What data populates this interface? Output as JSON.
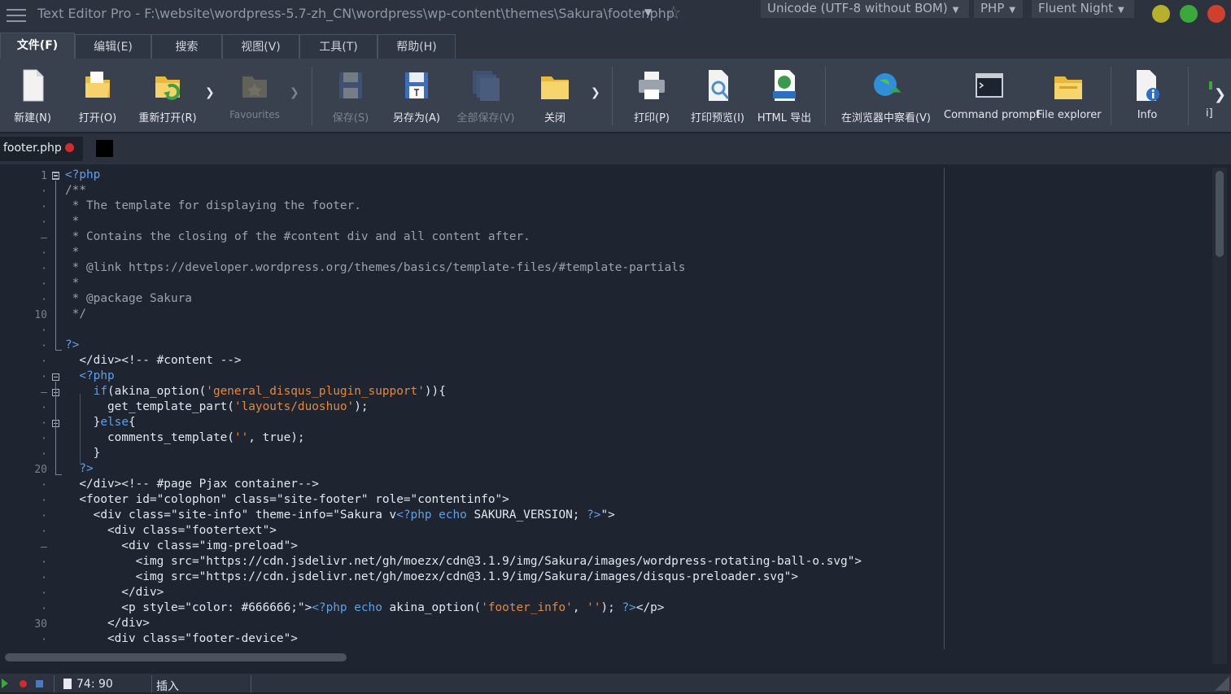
{
  "title": {
    "text": "Text Editor Pro  -  F:\\website\\wordpress-5.7-zh_CN\\wordpress\\wp-content\\themes\\Sakura\\footer.php",
    "encoding": "Unicode (UTF-8 without BOM)",
    "language": "PHP",
    "theme": "Fluent Night",
    "colors": {
      "minimize": "#b6b02a",
      "maximize": "#3aa83a",
      "close": "#d0402c"
    }
  },
  "menu_tabs": [
    "文件(F)",
    "编辑(E)",
    "搜索",
    "视图(V)",
    "工具(T)",
    "帮助(H)"
  ],
  "ribbon": {
    "new": "新建(N)",
    "open": "打开(O)",
    "reopen": "重新打开(R)",
    "favourites": "Favourites",
    "save": "保存(S)",
    "save_as": "另存为(A)",
    "save_all": "全部保存(V)",
    "close": "关闭",
    "print": "打印(P)",
    "print_preview": "打印预览(I)",
    "html_export": "HTML 导出",
    "view_in_browser": "在浏览器中察看(V)",
    "command_prompt": "Command prompt",
    "file_explorer": "File explorer",
    "info": "Info",
    "more_partial": "i]"
  },
  "doc_tab": {
    "name": "footer.php"
  },
  "line_numbers": {
    "n1": "1",
    "n10": "10",
    "n20": "20",
    "n30": "30"
  },
  "code": {
    "l1a": "<?php",
    "l2": "/**",
    "l3a": " * ",
    "l3b": "The template for displaying the footer.",
    "l4": " *",
    "l5a": " * ",
    "l5b": "Contains the closing of the #content div and all content after.",
    "l6": " *",
    "l7a": " * ",
    "l7b": "@link https://developer.wordpress.org/themes/basics/template-files/#template-partials",
    "l8": " *",
    "l9a": " * ",
    "l9b": "@package Sakura",
    "l10": " */",
    "l12": "?>",
    "l13": "  </div><!-- #content -->",
    "l14a": "  <?php",
    "l15a": "    if",
    "l15b": "(akina_option(",
    "l15c": "'general_disqus_plugin_support'",
    "l15d": ")){",
    "l16a": "      get_template_part(",
    "l16b": "'layouts/duoshuo'",
    "l16c": ");",
    "l17a": "    }",
    "l17b": "else",
    "l17c": "{",
    "l18a": "      comments_template(",
    "l18b": "''",
    "l18c": ", true);",
    "l19": "    }",
    "l20": "  ?>",
    "l21": "  </div><!-- #page Pjax container-->",
    "l22": "  <footer id=\"colophon\" class=\"site-footer\" role=\"contentinfo\">",
    "l23a": "    <div class=\"site-info\" theme-info=\"Sakura v",
    "l23b": "<?php echo",
    "l23c": " SAKURA_VERSION; ",
    "l23d": "?>",
    "l23e": "\">",
    "l24": "      <div class=\"footertext\">",
    "l25": "        <div class=\"img-preload\">",
    "l26": "          <img src=\"https://cdn.jsdelivr.net/gh/moezx/cdn@3.1.9/img/Sakura/images/wordpress-rotating-ball-o.svg\">",
    "l27": "          <img src=\"https://cdn.jsdelivr.net/gh/moezx/cdn@3.1.9/img/Sakura/images/disqus-preloader.svg\">",
    "l28": "        </div>",
    "l29a": "        <p style=\"color: #666666;\">",
    "l29b": "<?php echo",
    "l29c": " akina_option(",
    "l29d": "'footer_info'",
    "l29e": ", ",
    "l29f": "''",
    "l29g": "); ",
    "l29h": "?>",
    "l29i": "</p>",
    "l30": "      </div>",
    "l31": "      <div class=\"footer-device\">"
  },
  "status": {
    "position": "74: 90",
    "mode": "插入"
  }
}
